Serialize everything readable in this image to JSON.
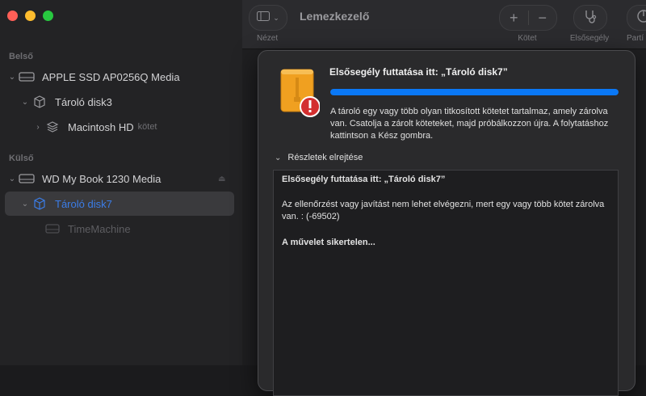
{
  "window": {
    "title": "Lemezkezelő"
  },
  "toolbar": {
    "view_label": "Nézet",
    "volume_label": "Kötet",
    "firstaid_label": "Elsősegély",
    "partition_label": "Partí"
  },
  "sidebar": {
    "internal_label": "Belső",
    "external_label": "Külső",
    "items": [
      {
        "label": "APPLE SSD AP0256Q Media",
        "sub": ""
      },
      {
        "label": "Tároló disk3",
        "sub": ""
      },
      {
        "label": "Macintosh HD",
        "sub": "kötet"
      },
      {
        "label": "WD My Book 1230 Media",
        "sub": ""
      },
      {
        "label": "Tároló disk7",
        "sub": ""
      },
      {
        "label": "TimeMachine",
        "sub": ""
      }
    ]
  },
  "dialog": {
    "title": "Elsősegély futtatása itt: „Tároló disk7”",
    "progress": 1.0,
    "message": "A tároló egy vagy több olyan titkosított kötetet tartalmaz, amely zárolva van. Csatolja a zárolt köteteket, majd próbálkozzon újra. A folytatáshoz kattintson a Kész gombra.",
    "details_toggle": "Részletek elrejtése",
    "log": {
      "line1": "Elsősegély futtatása itt: „Tároló disk7”",
      "line2": "Az ellenőrzést vagy javítást nem lehet elvégezni, mert egy vagy több kötet zárolva van. : (-69502)",
      "line3": "A művelet sikertelen..."
    }
  },
  "colors": {
    "accent": "#0a78f6",
    "selected_text": "#3b7de8",
    "alert": "#d32f2f",
    "disk_orange": "#f0a020"
  }
}
